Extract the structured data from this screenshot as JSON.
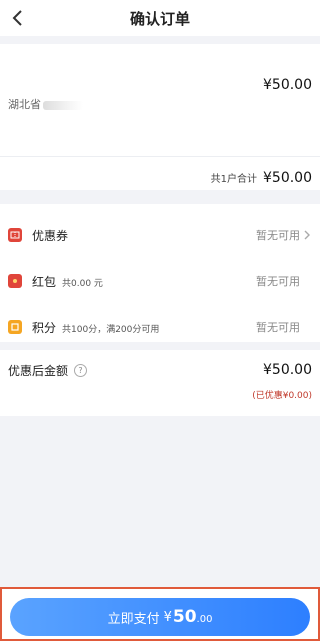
{
  "header": {
    "title": "确认订单",
    "back_icon": "back-arrow-icon"
  },
  "store": {
    "price": "¥50.00",
    "address_prefix": "湖北省",
    "total_label": "共1户合计",
    "total_value": "¥50.00"
  },
  "discounts": {
    "coupon": {
      "label": "优惠券",
      "status": "暂无可用",
      "icon": "coupon-icon",
      "color": "#e0453a"
    },
    "red_packet": {
      "label": "红包",
      "sub": "共0.00 元",
      "status": "暂无可用",
      "icon": "red-packet-icon",
      "color": "#e0453a"
    },
    "points": {
      "label": "积分",
      "sub": "共100分，满200分可用",
      "status": "暂无可用",
      "icon": "points-icon",
      "color": "#f5a623"
    }
  },
  "summary": {
    "label": "优惠后金额",
    "value": "¥50.00",
    "note": "(已优惠¥0.00)"
  },
  "pay": {
    "label": "立即支付",
    "currency": "¥",
    "amount_int": "50",
    "amount_dec": ".00",
    "border_color": "#e05a3a",
    "button_color": "#2d7fff"
  }
}
